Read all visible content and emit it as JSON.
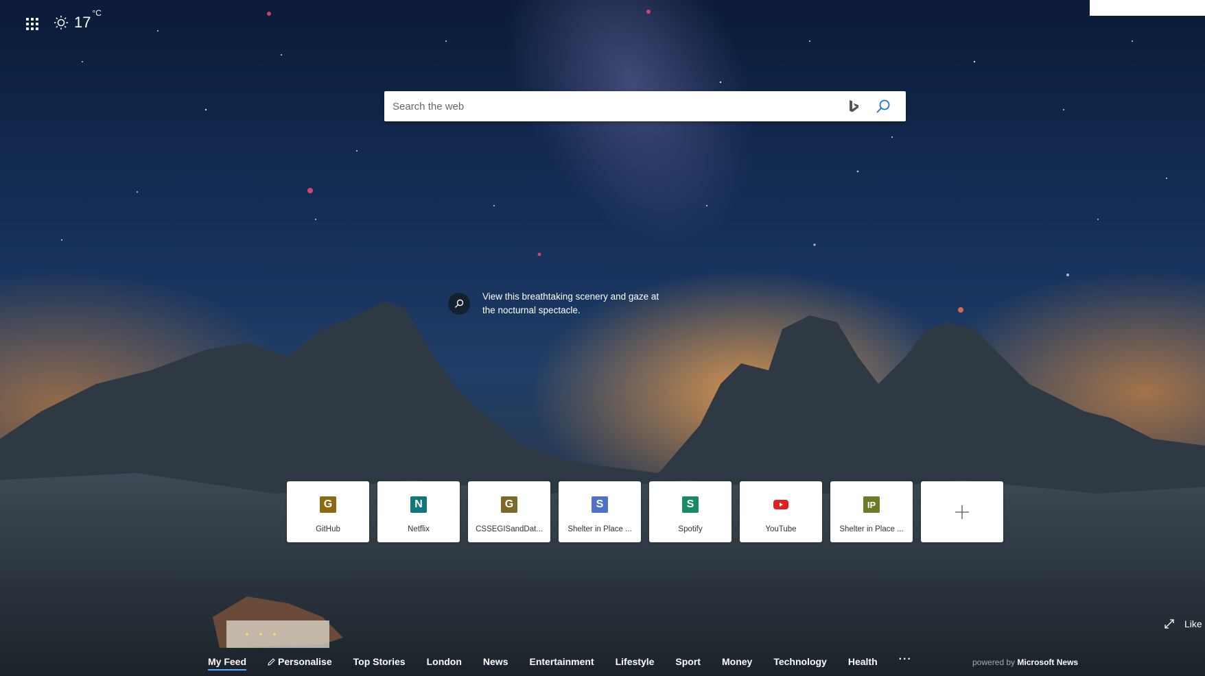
{
  "weather": {
    "temperature": "17",
    "unit": "°C",
    "icon": "sun-icon"
  },
  "search": {
    "placeholder": "Search the web"
  },
  "caption": {
    "text": "View this breathtaking scenery and gaze at the nocturnal spectacle."
  },
  "quick_links": [
    {
      "label": "GitHub",
      "letter": "G",
      "color": "#8a6b14"
    },
    {
      "label": "Netflix",
      "letter": "N",
      "color": "#11777a"
    },
    {
      "label": "CSSEGISandDat...",
      "letter": "G",
      "color": "#7c6a2a"
    },
    {
      "label": "Shelter in Place ...",
      "letter": "S",
      "color": "#4f72c8"
    },
    {
      "label": "Spotify",
      "letter": "S",
      "color": "#1b8a63"
    },
    {
      "label": "YouTube",
      "letter": "",
      "color": "#e01f1f",
      "icon": "youtube-icon"
    },
    {
      "label": "Shelter in Place ...",
      "letter": "IP",
      "color": "#6e7a28"
    }
  ],
  "like": {
    "label": "Like"
  },
  "nav": {
    "items": [
      "My Feed",
      "Personalise",
      "Top Stories",
      "London",
      "News",
      "Entertainment",
      "Lifestyle",
      "Sport",
      "Money",
      "Technology",
      "Health"
    ],
    "more": "···",
    "active": "My Feed"
  },
  "powered_by": {
    "prefix": "powered by",
    "brand": "Microsoft News"
  }
}
